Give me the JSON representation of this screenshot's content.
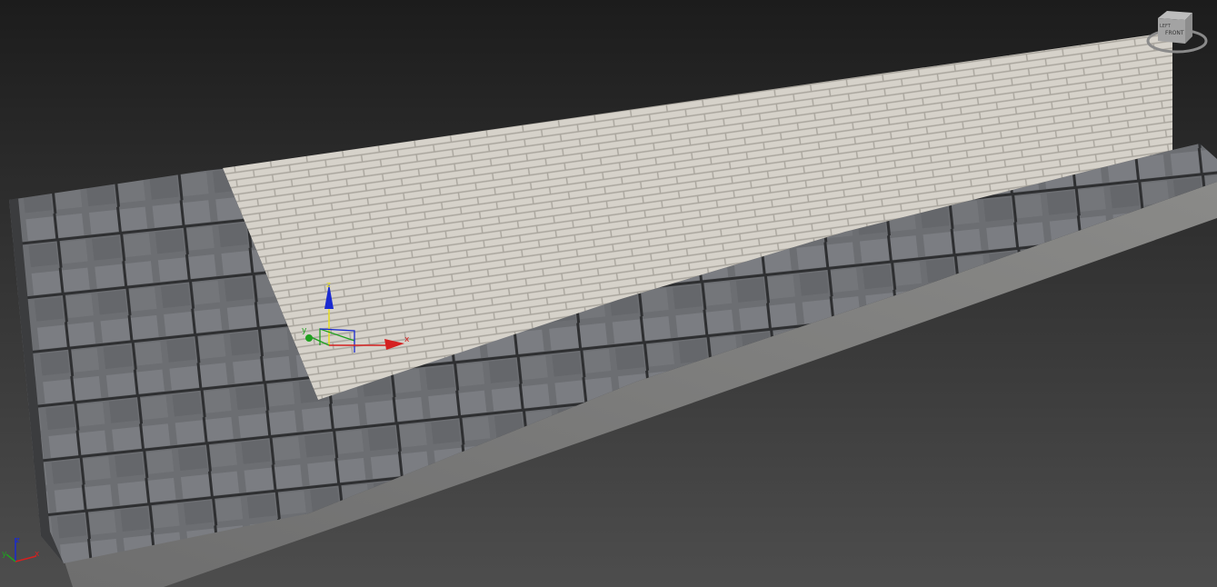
{
  "viewport": {
    "viewcube": {
      "face_label": "FRONT",
      "side_label": "LEFT"
    },
    "gizmo": {
      "x_label": "x",
      "y_label": "y",
      "z_label": "z"
    },
    "axis_tripod": {
      "x_label": "x",
      "y_label": "y",
      "z_label": "z"
    }
  },
  "colors": {
    "x_axis": "#d42020",
    "y_axis": "#20a020",
    "z_axis": "#1a2ad0",
    "gizmo_z_line": "#e8e020"
  }
}
